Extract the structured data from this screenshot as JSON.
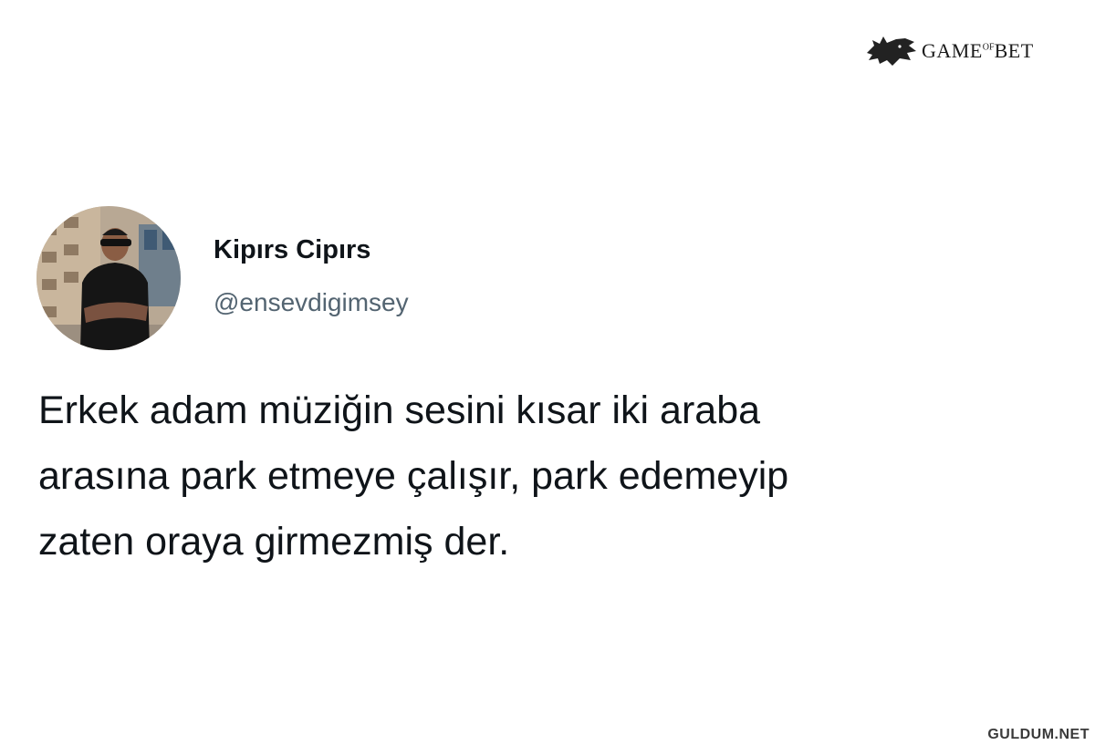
{
  "watermark_top": {
    "part1": "GAME",
    "part2": "OF",
    "part3": "BET",
    "icon": "wolf-head-icon"
  },
  "tweet": {
    "author_name": "Kipırs Cipırs",
    "author_handle": "@ensevdigimsey",
    "avatar": "profile-photo",
    "text_lines": [
      "Erkek adam müziğin sesini kısar iki araba",
      "arasına park etmeye çalışır, park edemeyip",
      "zaten oraya girmezmiş der."
    ]
  },
  "watermark_bottom": "GULDUM.NET"
}
